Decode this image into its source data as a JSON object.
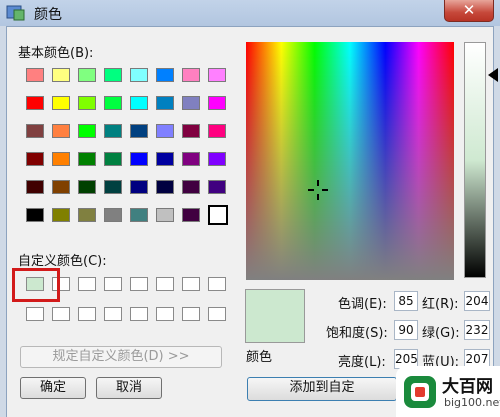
{
  "window": {
    "title": "颜色",
    "close_label": "✕"
  },
  "basic_colors_label": "基本颜色(B):",
  "basic_colors": [
    "#ff8080",
    "#ffff80",
    "#80ff80",
    "#00ff80",
    "#80ffff",
    "#0080ff",
    "#ff80c0",
    "#ff80ff",
    "#ff0000",
    "#ffff00",
    "#80ff00",
    "#00ff40",
    "#00ffff",
    "#0080c0",
    "#8080c0",
    "#ff00ff",
    "#804040",
    "#ff8040",
    "#00ff00",
    "#008080",
    "#004080",
    "#8080ff",
    "#800040",
    "#ff0080",
    "#800000",
    "#ff8000",
    "#008000",
    "#008040",
    "#0000ff",
    "#0000a0",
    "#800080",
    "#8000ff",
    "#400000",
    "#804000",
    "#004000",
    "#004040",
    "#000080",
    "#000040",
    "#400040",
    "#400080",
    "#000000",
    "#808000",
    "#808040",
    "#808080",
    "#408080",
    "#c0c0c0",
    "#400040",
    "#ffffff"
  ],
  "custom_colors_label": "自定义颜色(C):",
  "custom_colors": [
    "#cce8cf",
    "#ffffff",
    "#ffffff",
    "#ffffff",
    "#ffffff",
    "#ffffff",
    "#ffffff",
    "#ffffff",
    "#ffffff",
    "#ffffff",
    "#ffffff",
    "#ffffff",
    "#ffffff",
    "#ffffff",
    "#ffffff",
    "#ffffff"
  ],
  "define_custom_button": "规定自定义颜色(D) >>",
  "ok_button": "确定",
  "cancel_button": "取消",
  "add_custom_button": "添加到自定",
  "preview_label": "颜色",
  "preview_color": "#cce8cf",
  "fields": {
    "hue_label": "色调(E):",
    "hue_value": "85",
    "sat_label": "饱和度(S):",
    "sat_value": "90",
    "lum_label": "亮度(L):",
    "lum_value": "205",
    "red_label": "红(R):",
    "red_value": "204",
    "green_label": "绿(G):",
    "green_value": "232",
    "blue_label": "蓝(U):",
    "blue_value": "207"
  },
  "watermark": {
    "name": "大百网",
    "url": "big100.net"
  }
}
